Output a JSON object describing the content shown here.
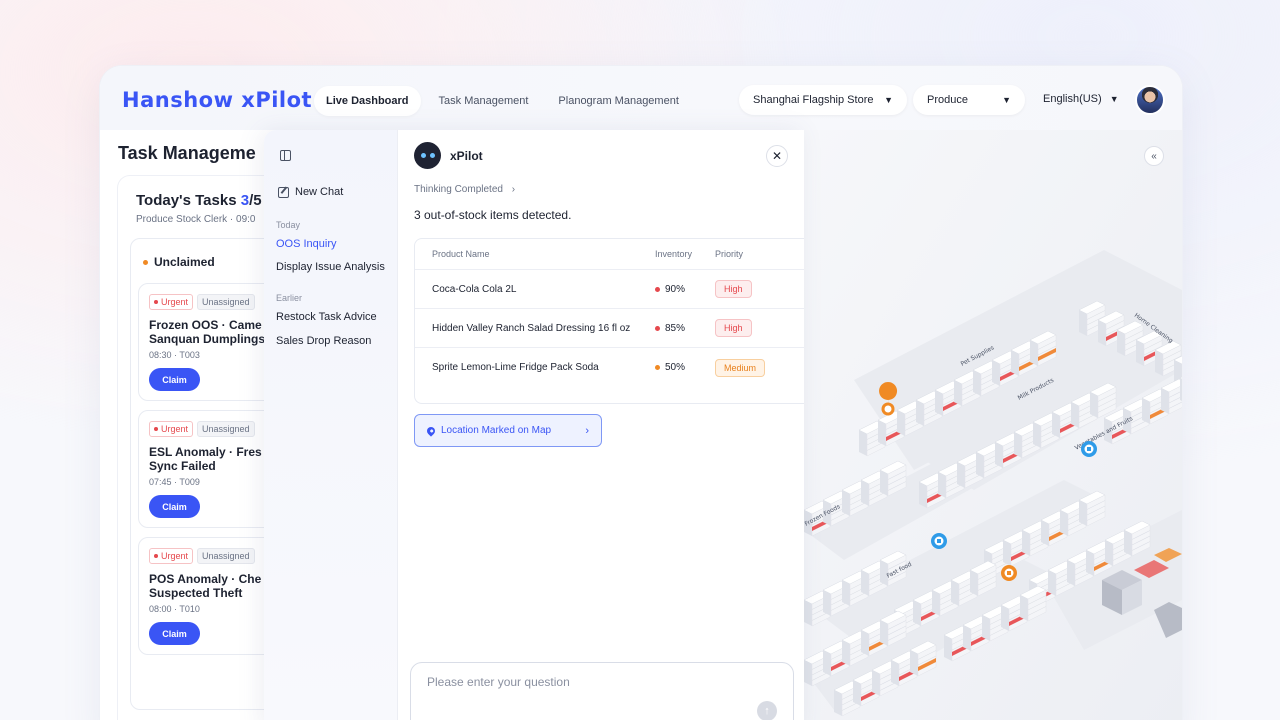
{
  "header": {
    "logo": "Hanshow xPilot",
    "nav": [
      {
        "label": "Live Dashboard",
        "active": true
      },
      {
        "label": "Task Management",
        "active": false
      },
      {
        "label": "Planogram Management",
        "active": false
      }
    ],
    "store_select": "Shanghai Flagship Store",
    "category_select": "Produce",
    "language": "English(US)"
  },
  "page": {
    "title": "Task Manageme",
    "tasks_heading": "Today's Tasks",
    "tasks_count": "3",
    "tasks_total": "/5",
    "tasks_sub": "Produce Stock Clerk · 09:0",
    "column": "Unclaimed",
    "tasks": [
      {
        "priority": "Urgent",
        "assignee": "Unassigned",
        "title_line1": "Frozen OOS · Came",
        "title_line2": "Sanquan Dumplings",
        "meta": "08:30 · T003",
        "action": "Claim"
      },
      {
        "priority": "Urgent",
        "assignee": "Unassigned",
        "title_line1": "ESL Anomaly · Fres",
        "title_line2": "Sync Failed",
        "meta": "07:45 · T009",
        "action": "Claim"
      },
      {
        "priority": "Urgent",
        "assignee": "Unassigned",
        "title_line1": "POS Anomaly · Che",
        "title_line2": "Suspected Theft",
        "meta": "08:00 · T010",
        "action": "Claim"
      }
    ]
  },
  "chat": {
    "new_chat": "New Chat",
    "groups": {
      "today": "Today",
      "earlier": "Earlier"
    },
    "history_today": [
      {
        "label": "OOS Inquiry",
        "active": true
      },
      {
        "label": "Display Issue Analysis",
        "active": false
      }
    ],
    "history_earlier": [
      {
        "label": "Restock Task Advice"
      },
      {
        "label": "Sales Drop Reason"
      }
    ],
    "bot_name": "xPilot",
    "thinking": "Thinking Completed",
    "message": "3 out-of-stock items detected.",
    "table": {
      "headers": [
        "Product Name",
        "Inventory",
        "Priority"
      ],
      "rows": [
        {
          "name": "Coca-Cola Cola 2L",
          "inventory": "90%",
          "inv_color": "#e5484d",
          "priority": "High"
        },
        {
          "name": "Hidden Valley Ranch Salad Dressing 16 fl oz",
          "inventory": "85%",
          "inv_color": "#e5484d",
          "priority": "High"
        },
        {
          "name": "Sprite Lemon-Lime Fridge Pack Soda",
          "inventory": "50%",
          "inv_color": "#f08a24",
          "priority": "Medium"
        }
      ]
    },
    "location_button": "Location Marked on Map",
    "input_placeholder": "Please enter your question"
  },
  "map": {
    "aisle_labels": [
      "Pet Supplies",
      "Milk Products",
      "Vegetables and Fruits",
      "Home Cleaning",
      "Frozen Foods",
      "Fast food"
    ]
  },
  "colors": {
    "accent": "#3a55f5",
    "high_bg": "#fdeeee",
    "high_fg": "#e5484d",
    "medium_bg": "#fff3e6",
    "medium_fg": "#e8811d"
  }
}
